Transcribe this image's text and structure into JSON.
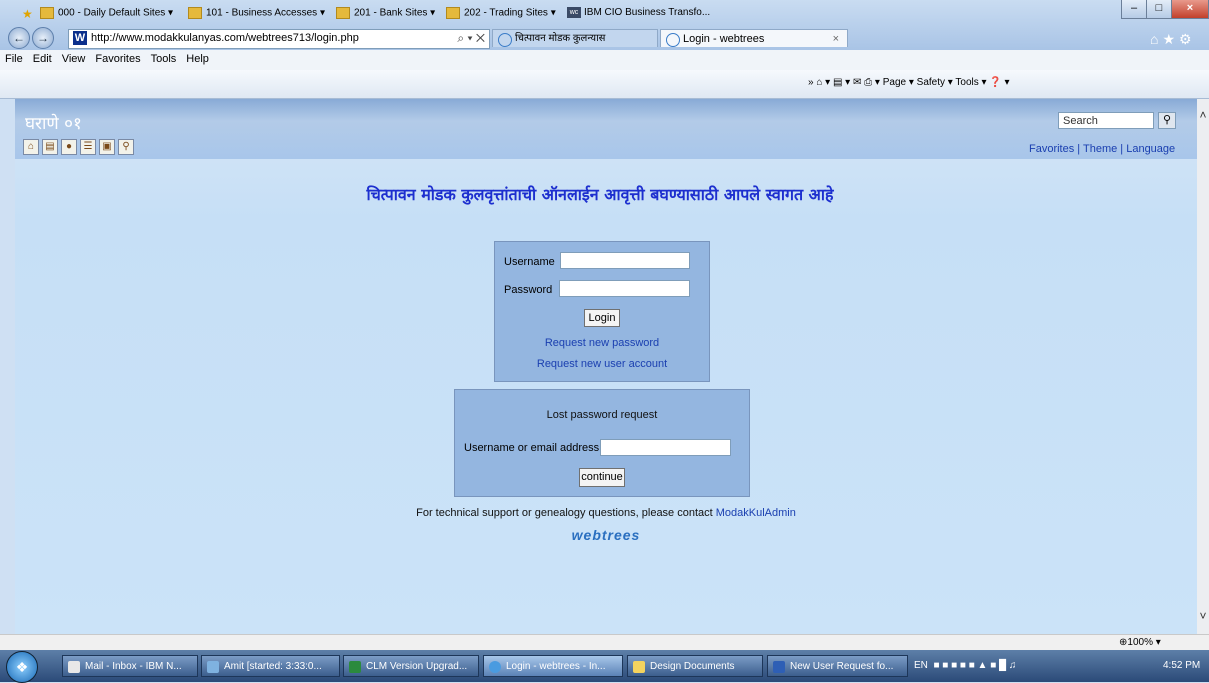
{
  "browser": {
    "address_url": "http://www.modakkulanyas.com/webtrees713/login.php",
    "address_tools": "⌕ ▾ ✕",
    "tabs": [
      {
        "label": "चित्पावन मोडक कुलन्यास"
      },
      {
        "label": "Login - webtrees"
      }
    ],
    "menu": [
      "File",
      "Edit",
      "View",
      "Favorites",
      "Tools",
      "Help"
    ],
    "favorites": [
      "000 - Daily Default Sites ▾",
      "101 - Business Accesses ▾",
      "201 - Bank Sites ▾",
      "202 - Trading Sites ▾",
      "IBM CIO Business Transfo..."
    ],
    "command_bar": "»  ⌂ ▾  ▤ ▾  ✉  ⎙ ▾  Page ▾  Safety ▾  Tools ▾  ❓ ▾",
    "zoom": "100%"
  },
  "site": {
    "title": "घराणे ०१",
    "search_placeholder": "Search",
    "header_links": "Favorites | Theme | Language",
    "welcome": "चित्पावन मोडक कुलवृत्तांताची ऑनलाईन आवृत्ती बघण्यासाठी आपले स्वागत आहे",
    "login": {
      "username_label": "Username",
      "password_label": "Password",
      "login_button": "Login",
      "request_password": "Request new password",
      "request_account": "Request new user account"
    },
    "lost_password": {
      "heading": "Lost password request",
      "field_label": "Username or email address",
      "continue_button": "continue"
    },
    "support_text": "For technical support or genealogy questions, please contact",
    "support_contact": "ModakKulAdmin",
    "logo_text": "webtrees"
  },
  "taskbar": {
    "items": [
      "Mail - Inbox - IBM N...",
      "Amit [started: 3:33:0...",
      "CLM Version Upgrad...",
      "Login - webtrees - In...",
      "Design Documents",
      "New User Request fo..."
    ],
    "lang": "EN",
    "clock": "4:52 PM"
  }
}
